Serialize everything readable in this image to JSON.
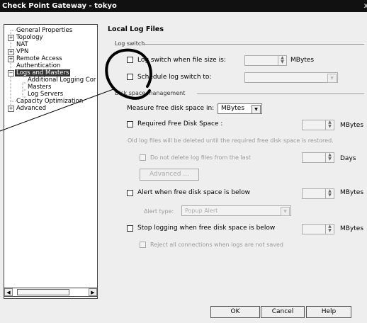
{
  "window": {
    "title": "Check Point Gateway - tokyo",
    "close_glyph": "x"
  },
  "tree": {
    "items": [
      {
        "label": "General Properties"
      },
      {
        "label": "Topology"
      },
      {
        "label": "NAT"
      },
      {
        "label": "VPN"
      },
      {
        "label": "Remote Access"
      },
      {
        "label": "Authentication"
      },
      {
        "label": "Logs and Masters"
      },
      {
        "label": "Additional Logging Cor"
      },
      {
        "label": "Masters"
      },
      {
        "label": "Log Servers"
      },
      {
        "label": "Capacity Optimization"
      },
      {
        "label": "Advanced"
      }
    ],
    "selected": "Logs and Masters"
  },
  "panel": {
    "title": "Local Log Files",
    "log_switch_group": "Log switch",
    "log_switch_size_label": "Log switch when file size is:",
    "log_switch_size_unit": "MBytes",
    "schedule_label": "Schedule log switch to:",
    "disk_group": "Disk space management",
    "measure_label": "Measure free disk space in:",
    "measure_value": "MBytes",
    "required_label": "Required Free Disk Space :",
    "required_unit": "MBytes",
    "old_files_note": "Old log files will be deleted until the required free disk space is restored.",
    "do_not_delete_label": "Do not delete log files from the last",
    "days_unit": "Days",
    "advanced_button": "Advanced ...",
    "alert_label": "Alert when free disk space is below",
    "alert_unit": "MBytes",
    "alert_type_label": "Alert type:",
    "alert_type_value": "Popup Alert",
    "stop_label": "Stop logging when free disk space is below",
    "stop_unit": "MBytes",
    "reject_label": "Reject all connections when logs are not saved"
  },
  "buttons": {
    "ok": "OK",
    "cancel": "Cancel",
    "help": "Help"
  }
}
